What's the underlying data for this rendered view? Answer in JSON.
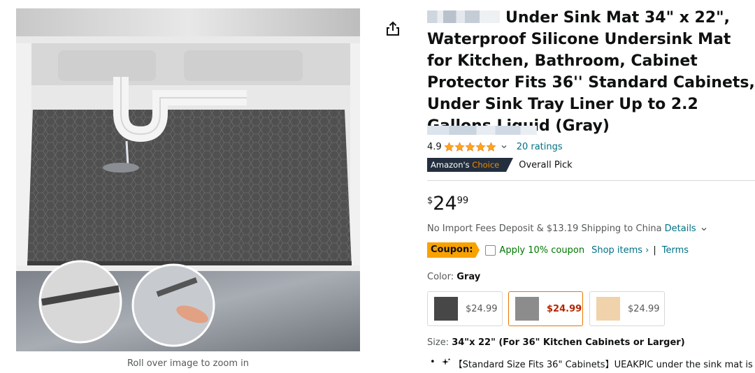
{
  "product": {
    "title": "Under Sink Mat 34\" x 22\", Waterproof Silicone Undersink Mat for Kitchen, Bathroom, Cabinet Protector Fits 36'' Standard Cabinets, Under Sink Tray Liner Up to 2.2 Gallons Liquid (Gray)"
  },
  "gallery": {
    "zoom_hint": "Roll over image to zoom in"
  },
  "rating": {
    "score": "4.9",
    "stars": 5,
    "ratings_link": "20 ratings"
  },
  "badge": {
    "prefix": "Amazon's",
    "accent": "Choice",
    "label": "Overall Pick"
  },
  "price": {
    "symbol": "$",
    "whole": "24",
    "fraction": "99"
  },
  "shipping": {
    "text": "No Import Fees Deposit & $13.19 Shipping to China",
    "details_link": "Details"
  },
  "coupon": {
    "badge": "Coupon:",
    "text": "Apply 10% coupon",
    "shop_link": "Shop items ›",
    "separator": "|",
    "terms_link": "Terms"
  },
  "color": {
    "label": "Color: ",
    "value": "Gray",
    "options": [
      {
        "price": "$24.99",
        "swatch": "#474747",
        "selected": false
      },
      {
        "price": "$24.99",
        "swatch": "#8c8c8c",
        "selected": true
      },
      {
        "price": "$24.99",
        "swatch": "#f0d3aa",
        "selected": false
      }
    ]
  },
  "size": {
    "label": "Size: ",
    "value": "34\"x 22\" (For 36\" Kitchen Cabinets or Larger)"
  },
  "bullets": [
    "【Standard Size Fits 36\" Cabinets】UEAKPIC under the sink mat is"
  ],
  "colors": {
    "link": "#007185",
    "star": "#ffa41c",
    "coupon_green": "#007600",
    "coupon_badge": "#f7a200",
    "price_selected": "#b12704",
    "choice_bg": "#232f3e",
    "choice_accent": "#f08804"
  },
  "icons": {
    "share": "share-icon",
    "rating_chevron": "chevron-down-icon",
    "details_chevron": "chevron-down-icon",
    "sparkle": "sparkle-icon"
  }
}
